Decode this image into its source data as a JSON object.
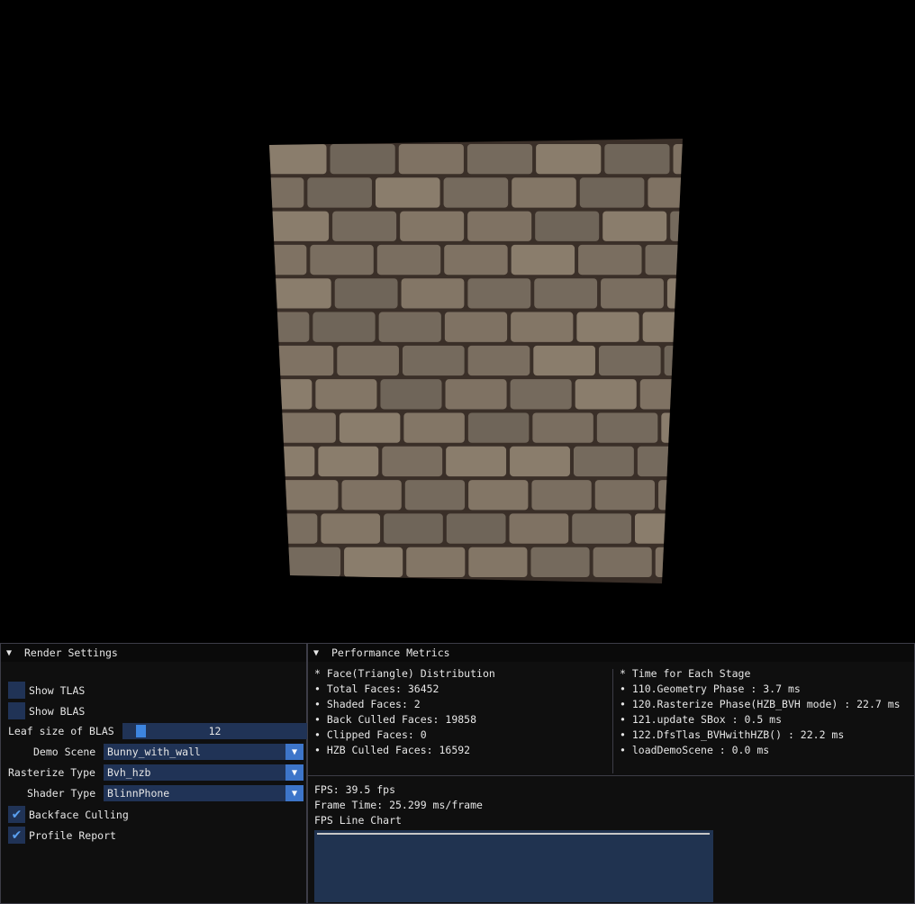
{
  "render_settings": {
    "title": "Render Settings",
    "show_tlas": {
      "label": "Show TLAS",
      "checked": false
    },
    "show_blas": {
      "label": "Show BLAS",
      "checked": false
    },
    "leaf_size": {
      "label": "Leaf size of BLAS",
      "value": "12"
    },
    "demo_scene": {
      "label": "Demo Scene",
      "value": "Bunny_with_wall"
    },
    "rasterize_type": {
      "label": "Rasterize Type",
      "value": "Bvh_hzb"
    },
    "shader_type": {
      "label": "Shader Type",
      "value": "BlinnPhone"
    },
    "backface_culling": {
      "label": "Backface Culling",
      "checked": true
    },
    "profile_report": {
      "label": "Profile Report",
      "checked": true
    }
  },
  "performance": {
    "title": "Performance Metrics",
    "faces": {
      "header": "Face(Triangle) Distribution",
      "items": [
        "Total Faces: 36452",
        "Shaded Faces: 2",
        "Back Culled Faces: 19858",
        "Clipped Faces: 0",
        "HZB Culled Faces: 16592"
      ]
    },
    "stages": {
      "header": "Time for Each Stage",
      "items": [
        "110.Geometry Phase : 3.7 ms",
        "120.Rasterize Phase(HZB_BVH mode) : 22.7 ms",
        "121.update SBox : 0.5 ms",
        "122.DfsTlas_BVHwithHZB() : 22.2 ms",
        "loadDemoScene : 0.0 ms"
      ]
    },
    "fps": "FPS: 39.5 fps",
    "frame_time": "Frame Time: 25.299 ms/frame",
    "chart_title": "FPS Line Chart"
  },
  "colors": {
    "frame_bg": "#203356",
    "accent": "#3d85e0",
    "checkmark": "#5aa0f0",
    "chart_bg": "#203350",
    "stone": "#7d7062",
    "mortar": "#3a2f28"
  },
  "icons": {
    "collapse": "triangle-down-icon",
    "checkbox": "checkmark-icon",
    "combo": "dropdown-arrow-icon"
  }
}
